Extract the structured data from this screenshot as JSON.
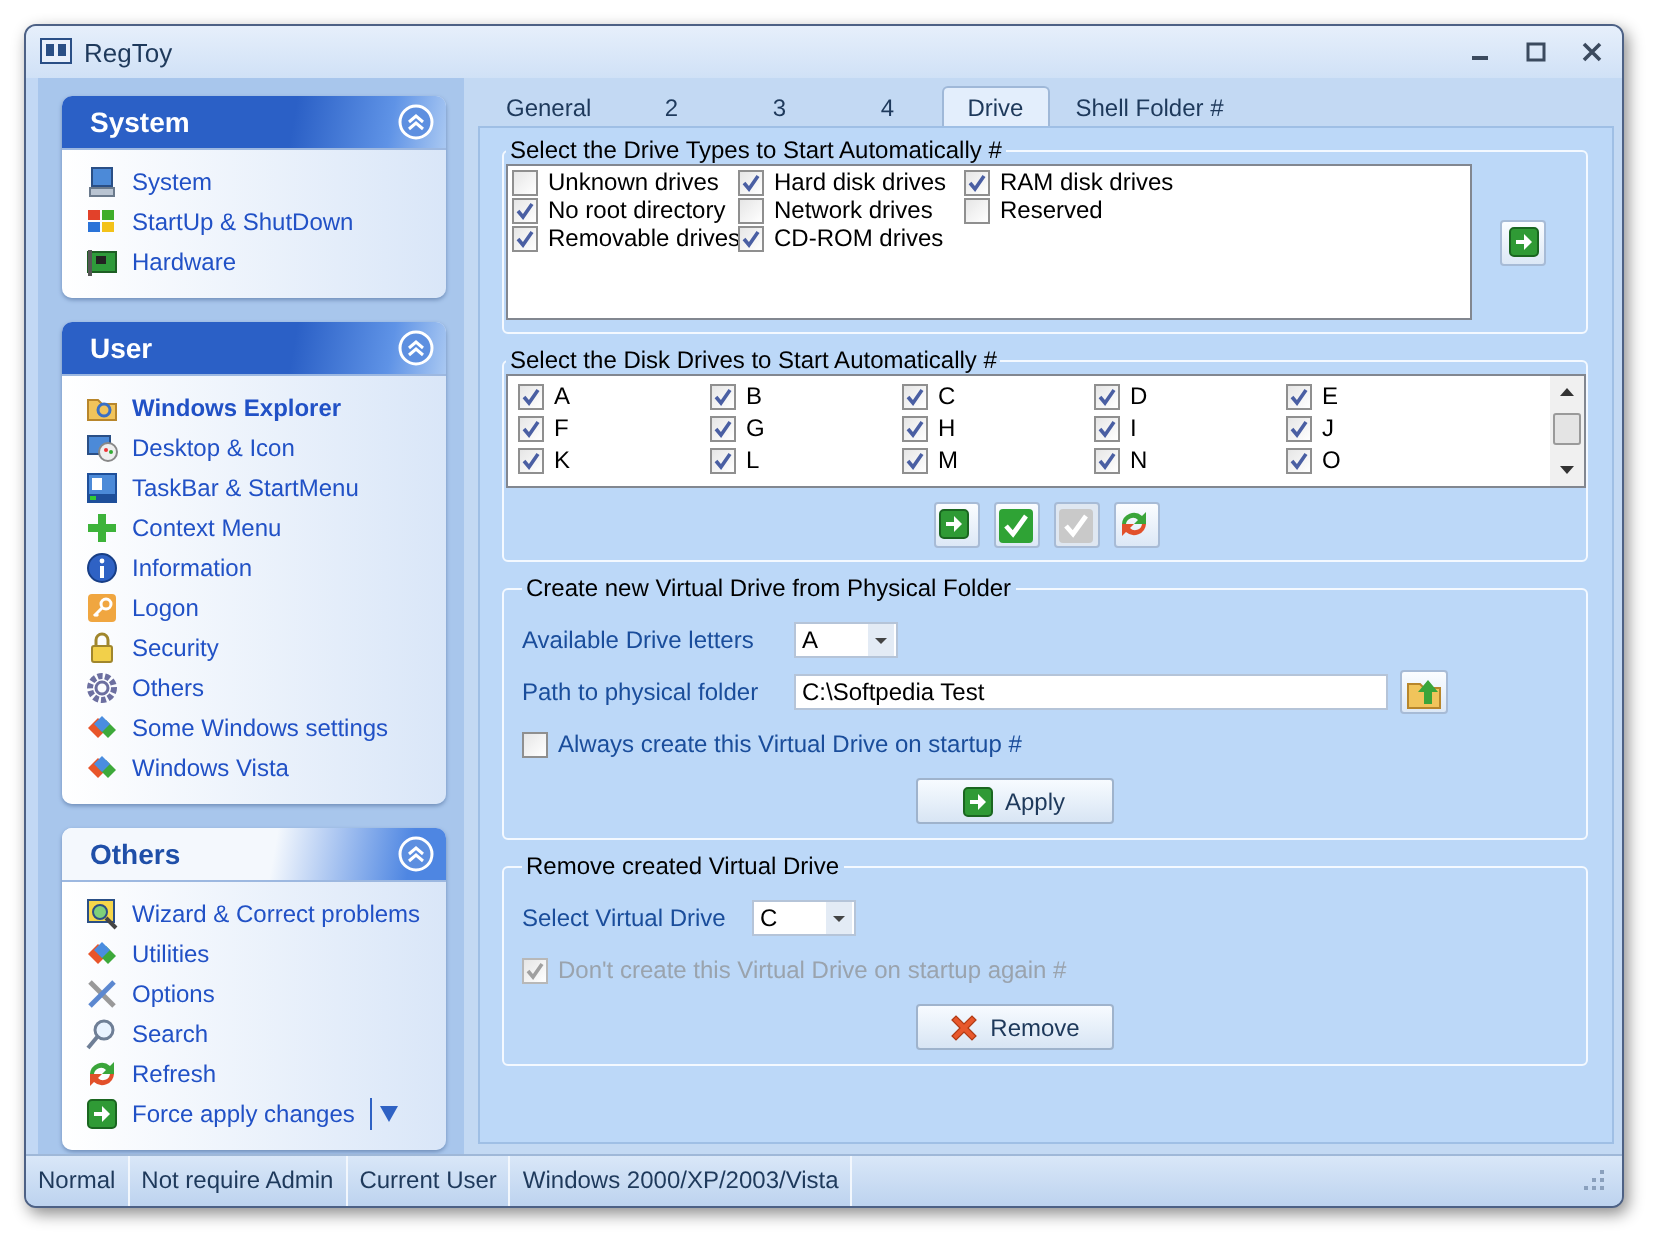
{
  "window": {
    "title": "RegToy"
  },
  "sidebar": {
    "groups": [
      {
        "title": "System",
        "expanded": true,
        "highlighted": true,
        "items": [
          {
            "label": "System",
            "selected": false,
            "has_menu": false
          },
          {
            "label": "StartUp & ShutDown",
            "selected": false,
            "has_menu": false
          },
          {
            "label": "Hardware",
            "selected": false,
            "has_menu": false
          }
        ]
      },
      {
        "title": "User",
        "expanded": true,
        "highlighted": true,
        "items": [
          {
            "label": "Windows Explorer",
            "selected": true,
            "has_menu": false
          },
          {
            "label": "Desktop & Icon",
            "selected": false,
            "has_menu": false
          },
          {
            "label": "TaskBar & StartMenu",
            "selected": false,
            "has_menu": false
          },
          {
            "label": "Context Menu",
            "selected": false,
            "has_menu": false
          },
          {
            "label": "Information",
            "selected": false,
            "has_menu": false
          },
          {
            "label": "Logon",
            "selected": false,
            "has_menu": false
          },
          {
            "label": "Security",
            "selected": false,
            "has_menu": false
          },
          {
            "label": "Others",
            "selected": false,
            "has_menu": false
          },
          {
            "label": "Some Windows settings",
            "selected": false,
            "has_menu": false
          },
          {
            "label": "Windows Vista",
            "selected": false,
            "has_menu": false
          }
        ]
      },
      {
        "title": "Others",
        "expanded": true,
        "highlighted": false,
        "items": [
          {
            "label": "Wizard & Correct problems",
            "selected": false,
            "has_menu": false
          },
          {
            "label": "Utilities",
            "selected": false,
            "has_menu": false
          },
          {
            "label": "Options",
            "selected": false,
            "has_menu": false
          },
          {
            "label": "Search",
            "selected": false,
            "has_menu": false
          },
          {
            "label": "Refresh",
            "selected": false,
            "has_menu": false
          },
          {
            "label": "Force apply changes",
            "selected": false,
            "has_menu": true
          }
        ]
      }
    ]
  },
  "tabs": [
    {
      "label": "General",
      "selected": false
    },
    {
      "label": "2",
      "selected": false
    },
    {
      "label": "3",
      "selected": false
    },
    {
      "label": "4",
      "selected": false
    },
    {
      "label": "Drive",
      "selected": true
    },
    {
      "label": "Shell Folder #",
      "selected": false
    }
  ],
  "drive_types": {
    "title": "Select the Drive Types to Start Automatically #",
    "items": [
      {
        "label": "Unknown drives",
        "checked": false
      },
      {
        "label": "No root directory",
        "checked": true
      },
      {
        "label": "Removable drives",
        "checked": true
      },
      {
        "label": "Hard disk drives",
        "checked": true
      },
      {
        "label": "Network drives",
        "checked": false
      },
      {
        "label": "CD-ROM drives",
        "checked": true
      },
      {
        "label": "RAM disk drives",
        "checked": true
      },
      {
        "label": "Reserved",
        "checked": false
      }
    ]
  },
  "disk_drives": {
    "title": "Select the Disk Drives to Start Automatically #",
    "items": [
      {
        "label": "A",
        "checked": true
      },
      {
        "label": "B",
        "checked": true
      },
      {
        "label": "C",
        "checked": true
      },
      {
        "label": "D",
        "checked": true
      },
      {
        "label": "E",
        "checked": true
      },
      {
        "label": "F",
        "checked": true
      },
      {
        "label": "G",
        "checked": true
      },
      {
        "label": "H",
        "checked": true
      },
      {
        "label": "I",
        "checked": true
      },
      {
        "label": "J",
        "checked": true
      },
      {
        "label": "K",
        "checked": true
      },
      {
        "label": "L",
        "checked": true
      },
      {
        "label": "M",
        "checked": true
      },
      {
        "label": "N",
        "checked": true
      },
      {
        "label": "O",
        "checked": true
      }
    ],
    "tool_buttons": [
      {
        "disabled": false
      },
      {
        "disabled": false
      },
      {
        "disabled": true
      },
      {
        "disabled": false
      }
    ]
  },
  "create_virtual_drive": {
    "title": "Create new Virtual Drive from Physical Folder",
    "letter_label": "Available Drive letters",
    "letter_value": "A",
    "path_label": "Path to physical folder",
    "path_value": "C:\\Softpedia Test",
    "startup": {
      "label": "Always create this Virtual Drive on startup #",
      "checked": false,
      "disabled": false
    },
    "button": "Apply"
  },
  "remove_virtual_drive": {
    "title": "Remove created Virtual Drive",
    "select_label": "Select Virtual Drive",
    "select_value": "C",
    "startup": {
      "label": "Don't create this Virtual Drive on startup again #",
      "checked": true,
      "disabled": true
    },
    "button": "Remove"
  },
  "status_bar": [
    "Normal",
    "Not require Admin",
    "Current User",
    "Windows 2000/XP/2003/Vista"
  ]
}
